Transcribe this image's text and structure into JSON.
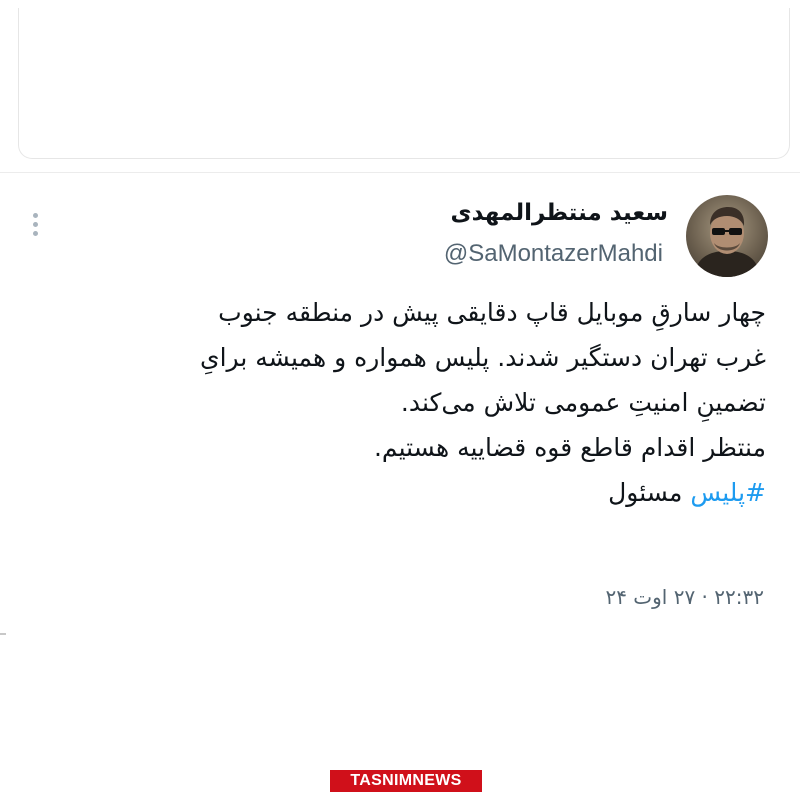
{
  "tweet": {
    "author_name": "سعید منتظرالمهدی",
    "author_handle": "@SaMontazerMahdi",
    "body_lines": [
      "چهار سارقِ موبایل قاپ دقایقی پیش در منطقه جنوب",
      "غرب تهران دستگیر شدند. پلیس همواره و همیشه برایِ",
      "تضمینِ امنیتِ عمومی تلاش می‌کند.",
      "منتظر اقدام قاطع قوه قضاییه هستیم."
    ],
    "hashtag": "#پلیس",
    "hashtag_suffix": " مسئول",
    "timestamp": "۲۲:۳۲ · ۲۷ اوت ۲۴",
    "accent_color": "#1d9bf0",
    "avatar_icon": "profile-photo",
    "menu_icon": "more-vertical-icon"
  },
  "watermark": {
    "text": "TASNIMNEWS",
    "color": "#d0101a"
  }
}
